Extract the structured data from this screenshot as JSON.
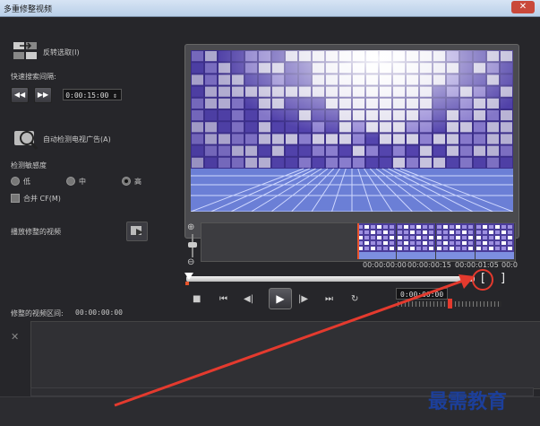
{
  "window": {
    "title": "多重修整视频",
    "close_glyph": "✕"
  },
  "left": {
    "invert_label": "反转选取(I)",
    "scan_label": "快速搜索间隔:",
    "rewind_glyph": "◀◀",
    "forward_glyph": "▶▶",
    "interval_value": "0:00:15:00",
    "detect_ads_label": "自动检测电视广告(A)",
    "sensitivity_label": "检测敏感度",
    "sens_low": "低",
    "sens_mid": "中",
    "sens_high": "高",
    "merge_label": "合并 CF(M)",
    "play_trimmed_label": "播放修整的视频",
    "trimmed_interval_label": "修整的视频区间:",
    "trimmed_interval_value": "00:00:00:00"
  },
  "timeline": {
    "ticks": [
      "00:00:00:00",
      "00:00:00:15",
      "00:00:01:05",
      "00:0"
    ],
    "current_time": "0:00:00:00",
    "mark_in_glyph": "[",
    "mark_out_glyph": "]"
  },
  "controls": {
    "stop": "■",
    "home": "⏮",
    "prev": "◀|",
    "play": "▶",
    "next": "|▶",
    "end": "⏭",
    "repeat": "↻"
  },
  "panel": {
    "delete_glyph": "✕"
  },
  "watermark": "最需教育",
  "colors": {
    "annotation": "#e43a2e",
    "highlight": "#e8542c",
    "bg": "#26262a"
  }
}
